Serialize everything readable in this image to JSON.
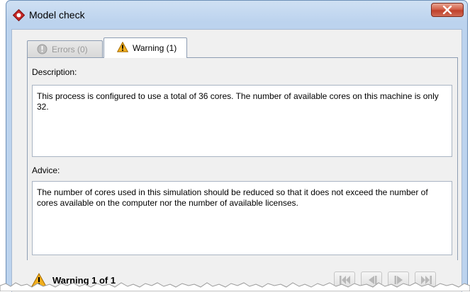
{
  "window": {
    "title": "Model check",
    "app_icon": "simulation-app-logo-icon",
    "close_icon": "close-x-icon"
  },
  "tabs": [
    {
      "label": "Errors (0)",
      "icon": "info-circle-icon",
      "active": false
    },
    {
      "label": "Warning (1)",
      "icon": "warning-triangle-icon",
      "active": true
    }
  ],
  "description": {
    "label": "Description:",
    "text": "This process is configured to use a total of 36 cores. The number of available cores on this machine is only 32."
  },
  "advice": {
    "label": "Advice:",
    "text": "The number of cores used in this simulation should be reduced so that it does not exceed the number of cores available on the computer nor the number of available licenses."
  },
  "footer": {
    "status": "Warning 1 of 1",
    "icon": "warning-triangle-icon",
    "nav_icons": [
      "first-page-icon",
      "previous-page-icon",
      "next-page-icon",
      "last-page-icon"
    ]
  },
  "colors": {
    "frame": "#bcd3ee",
    "close_button": "#c0412c",
    "warning": "#f2b01e"
  }
}
